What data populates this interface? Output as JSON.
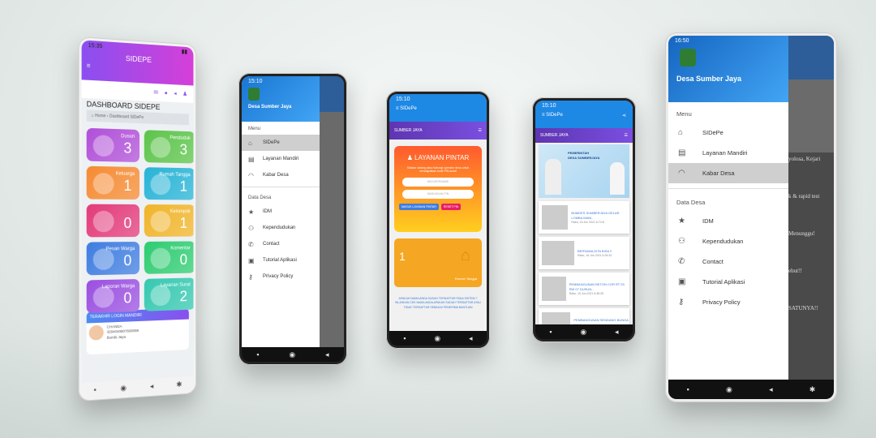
{
  "phone1": {
    "time": "15:35",
    "app_title": "SIDEPE",
    "dashboard_title": "DASHBOARD SIDEPE",
    "breadcrumb_home": "Home",
    "breadcrumb_current": "Dashboard SIDePe",
    "tiles": [
      {
        "label": "Dusun",
        "count": "3",
        "color": "#b04fd8"
      },
      {
        "label": "Penduduk",
        "count": "3",
        "color": "#5cc44a"
      },
      {
        "label": "Keluarga",
        "count": "1",
        "color": "#f58a32"
      },
      {
        "label": "Rumah Tangga",
        "count": "1",
        "color": "#27b3d6"
      },
      {
        "label": "",
        "count": "0",
        "color": "#e23a7a"
      },
      {
        "label": "Kelompok",
        "count": "1",
        "color": "#f0b429"
      },
      {
        "label": "Pesan Warga",
        "count": "0",
        "color": "#3f7de0"
      },
      {
        "label": "Komentar",
        "count": "0",
        "color": "#2ecc71"
      },
      {
        "label": "Laporan Warga",
        "count": "0",
        "color": "#9a4fe0"
      },
      {
        "label": "Layanan Surat",
        "count": "2",
        "color": "#35c8b0"
      }
    ],
    "login_title": "TERAKHIR LOGIN MANDIRI",
    "login_name": "CHANDA",
    "login_nik": "3294040807600098",
    "login_place": "Bumbi Jaya"
  },
  "phone2": {
    "time": "15:10",
    "drawer_title": "Desa Sumber Jaya",
    "menu_header": "Menu",
    "menu": [
      {
        "label": "SIDePe",
        "icon": "home-icon"
      },
      {
        "label": "Layanan Mandiri",
        "icon": "document-icon"
      },
      {
        "label": "Kabar Desa",
        "icon": "headphones-icon"
      }
    ],
    "data_header": "Data Desa",
    "data_menu": [
      {
        "label": "IDM",
        "icon": "star-icon"
      },
      {
        "label": "Kependudukan",
        "icon": "people-icon"
      },
      {
        "label": "Contact",
        "icon": "phone-icon"
      },
      {
        "label": "Tutorial Aplikasi",
        "icon": "image-icon"
      },
      {
        "label": "Privacy Policy",
        "icon": "key-icon"
      }
    ]
  },
  "phone3": {
    "time": "15:10",
    "app_title": "SIDePe",
    "sub_title": "SUMBER JAYA",
    "card_title": "LAYANAN PINTAR",
    "welcome": "Silakan datang atau hubungi operator desa untuk mendapatkan kode PIN anda!",
    "nik_placeholder": "NIK/USERNAME",
    "pin_placeholder": "MASUKKAN PIN",
    "login_button": "MASUK LAYANAN PINTAR",
    "reset_button": "RESET PIN",
    "house_count": "1",
    "house_label": "Rumah Tangga",
    "info": "APAKAH NAMA ANDA SUDAH TERDAFTAR PADA SISTEM ? SILAHKAN CEK NAMA ANDA APAKAH SUDAH TERDAFTAR ATAU TIDAK TERDAFTAR SEBAGAI PENERIMA BANTUAN"
  },
  "phone4": {
    "time": "15:10",
    "app_title": "SIDePe",
    "sub_title": "SUMBER JAYA",
    "banner_line1": "PEMERINTAH",
    "banner_line2": "DESA SUMBERJAYA",
    "news": [
      {
        "title": "BUMDES SUMBERJAYA GELAR LOMBA MANI...",
        "time": "Rabu, 16 Jun 2021 6:74:8"
      },
      {
        "title": "BERSAMA KITA BISA !!",
        "time": "Rabu, 16 Jun 2021 6:25:32"
      },
      {
        "title": "PEMBANGUNAN BETON COR RT 03 RW 07 DUSUN...",
        "time": "Rabu, 16 Jun 2021 6:36:28"
      },
      {
        "title": "PEMBANGUNAN SENDANG BUNGA INKA",
        "time": "Rabu, 16 Jun 2021 6:34:21"
      },
      {
        "title": "PEMBANGUNAN RABAT BETON",
        "time": ""
      }
    ]
  },
  "phone5": {
    "time": "16:50",
    "drawer_title": "Desa Sumber Jaya",
    "menu_header": "Menu",
    "menu": [
      {
        "label": "SIDePe",
        "icon": "home-icon"
      },
      {
        "label": "Layanan Mandiri",
        "icon": "document-icon"
      },
      {
        "label": "Kabar Desa",
        "icon": "headphones-icon"
      }
    ],
    "data_header": "Data Desa",
    "data_menu": [
      {
        "label": "IDM",
        "icon": "star-icon"
      },
      {
        "label": "Kependudukan",
        "icon": "people-icon"
      },
      {
        "label": "Contact",
        "icon": "phone-icon"
      },
      {
        "label": "Tutorial Aplikasi",
        "icon": "image-icon"
      },
      {
        "label": "Privacy Policy",
        "icon": "key-icon"
      }
    ],
    "bg_texts": [
      "yolosa, Kejari",
      "k & rapid test",
      "Menunggu!",
      "ebut!!",
      "SATUNYA!!"
    ]
  }
}
